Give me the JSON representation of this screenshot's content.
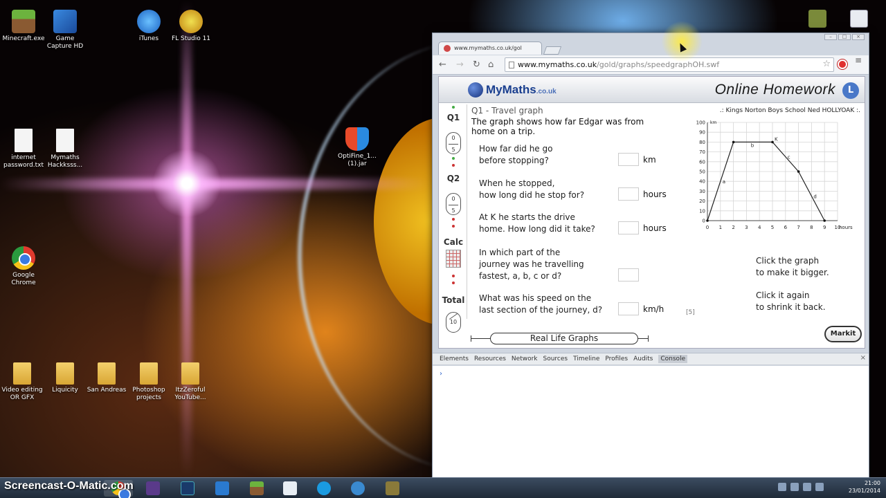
{
  "desktop": {
    "icons": [
      {
        "label": "Minecraft.exe"
      },
      {
        "label": "Game Capture HD"
      },
      {
        "label": "iTunes"
      },
      {
        "label": "FL Studio 11"
      },
      {
        "label": "internet password.txt"
      },
      {
        "label": "Mymaths Hackksss..."
      },
      {
        "label": "OptiFine_1... (1).jar"
      },
      {
        "label": "Google Chrome"
      },
      {
        "label": "Video editing OR GFX"
      },
      {
        "label": "Liquicity"
      },
      {
        "label": "San Andreas"
      },
      {
        "label": "Photoshop projects"
      },
      {
        "label": "ItzZeroful YouTube..."
      }
    ]
  },
  "browser": {
    "tab_title": "www.mymaths.co.uk/gol",
    "address_host": "www.mymaths.co.uk",
    "address_path": "/gold/graphs/speedgraphOH.swf",
    "icons": {
      "back": "back-arrow-icon",
      "forward": "forward-arrow-icon",
      "reload": "reload-icon",
      "home": "home-icon",
      "star": "star-icon",
      "menu": "menu-icon"
    }
  },
  "mymaths": {
    "logo": "MyMaths",
    "logo_suffix": ".co.uk",
    "header_title": "Online Homework",
    "question_title": "Q1 - Travel graph",
    "school_line": ".: Kings Norton Boys School  Ned HOLLYOAK :.",
    "intro": "The graph shows how far Edgar was from home on a trip.",
    "sidebar": [
      {
        "label": "Q1",
        "score_top": "0",
        "score_bottom": "5"
      },
      {
        "label": "Q2",
        "score_top": "0",
        "score_bottom": "5"
      },
      {
        "label": "Calc"
      },
      {
        "label": "Total",
        "score_top": "",
        "score_bottom": "10"
      }
    ],
    "questions": [
      {
        "line1": "How far did he go",
        "line2": "before stopping?",
        "unit": "km",
        "answer": ""
      },
      {
        "line1": "When he stopped,",
        "line2": "how long did he stop for?",
        "unit": "hours",
        "answer": ""
      },
      {
        "line1": "At K he starts the drive",
        "line2": "home. How long did it take?",
        "unit": "hours",
        "answer": ""
      },
      {
        "line1": "In which part of the",
        "line2": "journey was he travelling",
        "line3": "fastest, a, b, c or d?",
        "unit": "",
        "answer": ""
      },
      {
        "line1": "What was his speed on the",
        "line2": "last section of the journey, d?",
        "unit": "km/h",
        "answer": ""
      }
    ],
    "hint1_line1": "Click the graph",
    "hint1_line2": "to make it bigger.",
    "hint2_line1": "Click it again",
    "hint2_line2": "to shrink it back.",
    "marks": "[5]",
    "markit_label": "Markit",
    "topic_label": "Real Life Graphs"
  },
  "chart_data": {
    "type": "line",
    "x": [
      0,
      2,
      5,
      7,
      9
    ],
    "y": [
      0,
      80,
      80,
      50,
      0
    ],
    "xlabel": "hours",
    "ylabel": "km",
    "xlim": [
      0,
      10
    ],
    "ylim": [
      0,
      100
    ],
    "xticks": [
      "0",
      "1",
      "2",
      "3",
      "4",
      "5",
      "6",
      "7",
      "8",
      "9",
      "10"
    ],
    "yticks": [
      "0",
      "10",
      "20",
      "30",
      "40",
      "50",
      "60",
      "70",
      "80",
      "90",
      "100"
    ],
    "segment_labels": [
      "a",
      "b",
      "c",
      "d"
    ],
    "point_label": "K",
    "grid": true
  },
  "devtools": {
    "tabs": [
      "Elements",
      "Resources",
      "Network",
      "Sources",
      "Timeline",
      "Profiles",
      "Audits",
      "Console"
    ],
    "active_tab": "Console",
    "prompt": "›"
  },
  "taskbar": {
    "watermark": "Screencast-O-Matic.com",
    "time": "21:00",
    "date": "23/01/2014"
  }
}
